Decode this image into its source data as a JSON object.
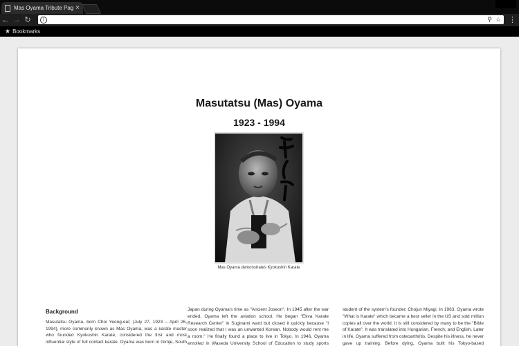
{
  "browser": {
    "tab_title": "Mas Oyama Tribute Page",
    "tab_close": "×",
    "address_value": "",
    "bookmarks_label": "Bookmarks"
  },
  "page": {
    "title": "Masutatsu (Mas) Oyama",
    "years": "1923 - 1994",
    "caption": "Mas Oyama demonstrates Kyokushin Karate",
    "background_heading": "Background",
    "col1_text": "Masutatsu Oyama, born Choi Yeong-eui; (July 27, 1923 – April 26, 1994), more commonly known as Mas Oyama, was a karate master who founded Kyokushin Karate, considered the first and most influential style of full contact karate. Oyama was born in Gimje, South Korea, during Japanese occupation. At a young age",
    "col2_text": "Japan during Oyama's time as \"Ancient Joseon\". In 1945 after the war ended, Oyama left the aviation school. He began \"Ekva Karate Research Center\" in Suginami ward but closed it quickly because \"I soon realized that I was an unwanted Korean. Nobody would rent me a room.\" He finally found a place to live in Tokyo. In 1946, Oyama enrolled in Waseda University School of Education to study sports science. Wanting the best in instruction,",
    "col3_text": "student of the system's founder, Chojun Miyagi. In 1963, Oyama wrote \"What is Karate\" which became a best seller in the US and sold million copies all over the world. It is still considered by many to be the \"Bible of Karate\". It was translated into Hungarian, French, and English. Later in life, Oyama suffered from osteoarthritis. Despite his illness, he never gave up training. Before dying, Oyama built his Tokyo-based International Karate"
  }
}
